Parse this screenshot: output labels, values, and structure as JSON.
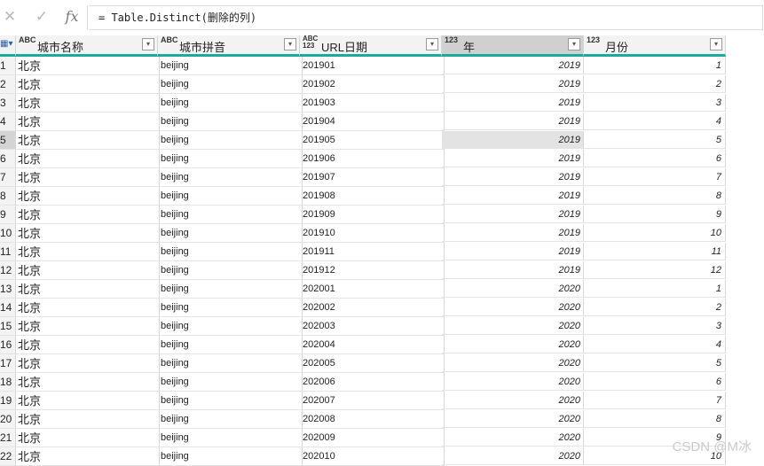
{
  "formula_bar": {
    "cancel_icon": "close-icon",
    "confirm_icon": "check-icon",
    "fx_label": "fx",
    "formula": "= Table.Distinct(删除的列)"
  },
  "table": {
    "corner_icon": "table-menu-icon",
    "columns": [
      {
        "type_label": "ABC",
        "name": "城市名称",
        "dropdown": "▾"
      },
      {
        "type_label": "ABC",
        "name": "城市拼音",
        "dropdown": "▾"
      },
      {
        "type_label": "ABC 123",
        "name": "URL日期",
        "dropdown": "▾"
      },
      {
        "type_label": "123",
        "name": "年",
        "dropdown": "▾"
      },
      {
        "type_label": "123",
        "name": "月份",
        "dropdown": "▾"
      }
    ],
    "rows": [
      [
        "1",
        "北京",
        "beijing",
        "201901",
        "2019",
        "1"
      ],
      [
        "2",
        "北京",
        "beijing",
        "201902",
        "2019",
        "2"
      ],
      [
        "3",
        "北京",
        "beijing",
        "201903",
        "2019",
        "3"
      ],
      [
        "4",
        "北京",
        "beijing",
        "201904",
        "2019",
        "4"
      ],
      [
        "5",
        "北京",
        "beijing",
        "201905",
        "2019",
        "5"
      ],
      [
        "6",
        "北京",
        "beijing",
        "201906",
        "2019",
        "6"
      ],
      [
        "7",
        "北京",
        "beijing",
        "201907",
        "2019",
        "7"
      ],
      [
        "8",
        "北京",
        "beijing",
        "201908",
        "2019",
        "8"
      ],
      [
        "9",
        "北京",
        "beijing",
        "201909",
        "2019",
        "9"
      ],
      [
        "10",
        "北京",
        "beijing",
        "201910",
        "2019",
        "10"
      ],
      [
        "11",
        "北京",
        "beijing",
        "201911",
        "2019",
        "11"
      ],
      [
        "12",
        "北京",
        "beijing",
        "201912",
        "2019",
        "12"
      ],
      [
        "13",
        "北京",
        "beijing",
        "202001",
        "2020",
        "1"
      ],
      [
        "14",
        "北京",
        "beijing",
        "202002",
        "2020",
        "2"
      ],
      [
        "15",
        "北京",
        "beijing",
        "202003",
        "2020",
        "3"
      ],
      [
        "16",
        "北京",
        "beijing",
        "202004",
        "2020",
        "4"
      ],
      [
        "17",
        "北京",
        "beijing",
        "202005",
        "2020",
        "5"
      ],
      [
        "18",
        "北京",
        "beijing",
        "202006",
        "2020",
        "6"
      ],
      [
        "19",
        "北京",
        "beijing",
        "202007",
        "2020",
        "7"
      ],
      [
        "20",
        "北京",
        "beijing",
        "202008",
        "2020",
        "8"
      ],
      [
        "21",
        "北京",
        "beijing",
        "202009",
        "2020",
        "9"
      ],
      [
        "22",
        "北京",
        "beijing",
        "202010",
        "2020",
        "10"
      ]
    ],
    "selected_column_index": 3,
    "selected_row_index": 4
  },
  "watermark": "CSDN @M冰",
  "colors": {
    "header_accent": "#1aab9b"
  }
}
